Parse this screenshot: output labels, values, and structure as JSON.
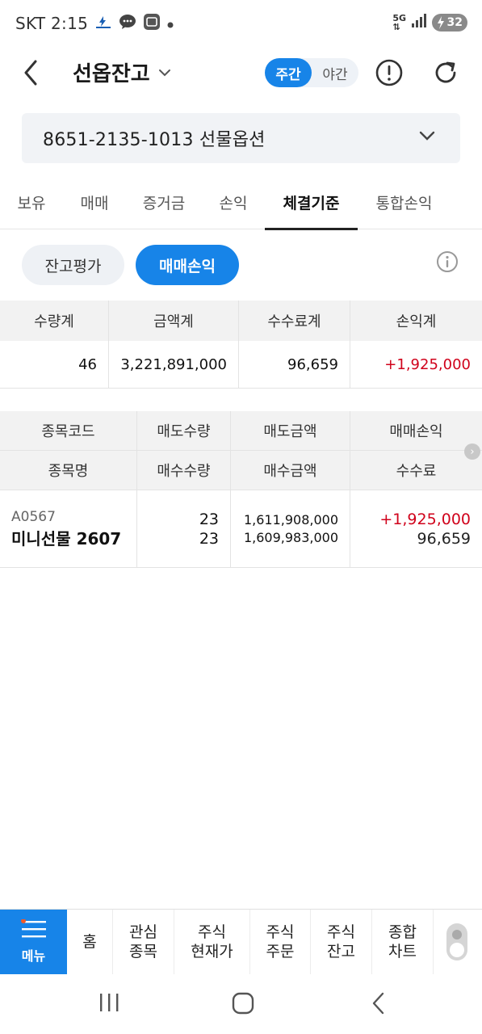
{
  "status_bar": {
    "carrier_time": "SKT 2:15",
    "network": "5G",
    "battery": "32"
  },
  "header": {
    "title": "선옵잔고",
    "session_day": "주간",
    "session_night": "야간"
  },
  "account": {
    "label": "8651-2135-1013 선물옵션"
  },
  "tabs": [
    {
      "label": "보유"
    },
    {
      "label": "매매"
    },
    {
      "label": "증거금"
    },
    {
      "label": "손익"
    },
    {
      "label": "체결기준"
    },
    {
      "label": "통합손익"
    }
  ],
  "sub_toggle": {
    "balance_eval": "잔고평가",
    "trade_pl": "매매손익"
  },
  "summary": {
    "headers": [
      "수량계",
      "금액계",
      "수수료계",
      "손익계"
    ],
    "values": [
      "46",
      "3,221,891,000",
      "96,659",
      "+1,925,000"
    ]
  },
  "detail": {
    "headers_top": [
      "종목코드",
      "매도수량",
      "매도금액",
      "매매손익"
    ],
    "headers_bottom": [
      "종목명",
      "매수수량",
      "매수금액",
      "수수료"
    ],
    "rows": [
      {
        "code": "A0567",
        "name": "미니선물 2607",
        "sell_qty": "23",
        "buy_qty": "23",
        "sell_amount": "1,611,908,000",
        "buy_amount": "1,609,983,000",
        "trade_pl": "+1,925,000",
        "fee": "96,659"
      }
    ]
  },
  "bottom_nav": {
    "menu": "메뉴",
    "items": [
      {
        "label": "홈"
      },
      {
        "label": "관심\n종목"
      },
      {
        "label": "주식\n현재가"
      },
      {
        "label": "주식\n주문"
      },
      {
        "label": "주식\n잔고"
      },
      {
        "label": "종합\n차트"
      }
    ]
  },
  "colors": {
    "accent": "#1784e8",
    "profit": "#d0021b"
  }
}
